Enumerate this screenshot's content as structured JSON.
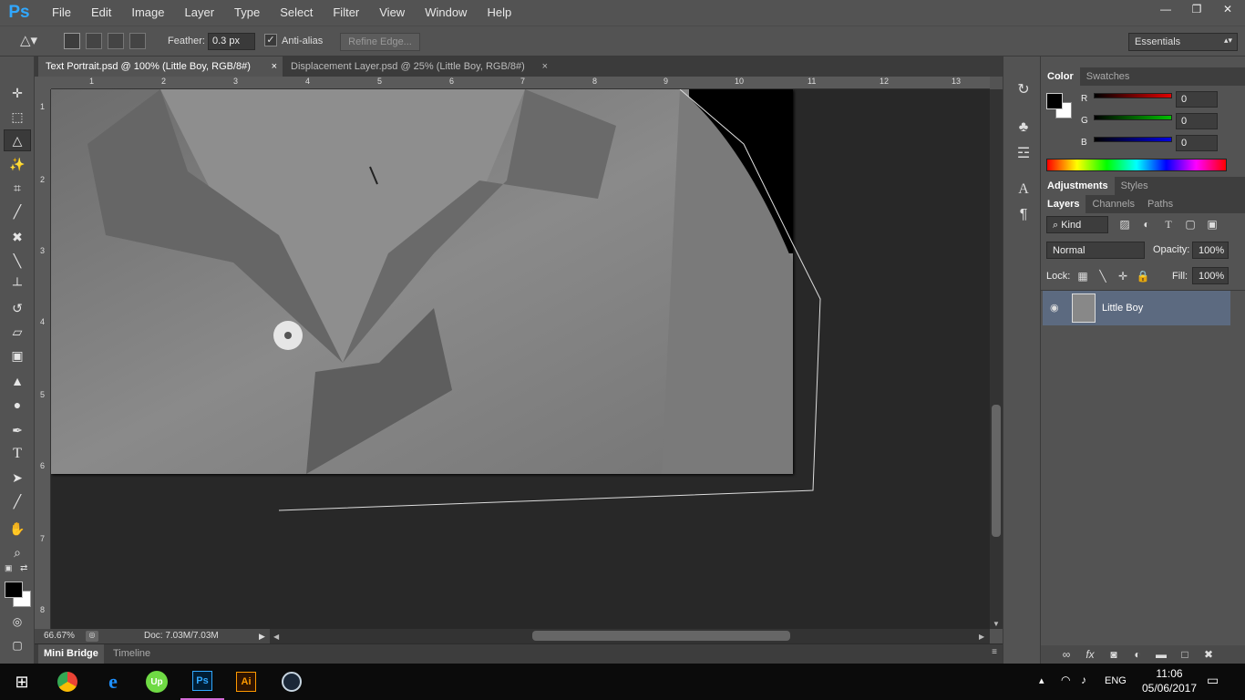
{
  "app": {
    "logo": "Ps"
  },
  "menu": [
    "File",
    "Edit",
    "Image",
    "Layer",
    "Type",
    "Select",
    "Filter",
    "View",
    "Window",
    "Help"
  ],
  "window_controls": [
    "minimize-icon",
    "restore-icon",
    "close-icon"
  ],
  "options": {
    "feather_label": "Feather:",
    "feather_value": "0.3 px",
    "antialias_label": "Anti-alias",
    "antialias_checked": true,
    "refine_edge_label": "Refine Edge...",
    "workspace": "Essentials"
  },
  "doc_tabs": [
    {
      "title": "Text Portrait.psd @ 100% (Little Boy, RGB/8#)",
      "active": true
    },
    {
      "title": "Displacement Layer.psd @ 25% (Little Boy, RGB/8#)",
      "active": false
    }
  ],
  "ruler": {
    "top": [
      "1",
      "2",
      "3",
      "4",
      "5",
      "6",
      "7",
      "8",
      "9",
      "10",
      "11",
      "12",
      "13"
    ],
    "left": [
      "1",
      "2",
      "3",
      "4",
      "5",
      "6",
      "7",
      "8"
    ]
  },
  "status": {
    "zoom": "66.67%",
    "doc": "Doc: 7.03M/7.03M"
  },
  "bridge_tabs": [
    "Mini Bridge",
    "Timeline"
  ],
  "color_panel": {
    "tabs": [
      "Color",
      "Swatches"
    ],
    "channels": [
      {
        "label": "R",
        "value": "0",
        "color": "#e00000"
      },
      {
        "label": "G",
        "value": "0",
        "color": "#00c000"
      },
      {
        "label": "B",
        "value": "0",
        "color": "#0000e0"
      }
    ],
    "foreground": "#000000",
    "background": "#ffffff"
  },
  "adjustments_tabs": [
    "Adjustments",
    "Styles"
  ],
  "layers_panel": {
    "tabs": [
      "Layers",
      "Channels",
      "Paths"
    ],
    "filter_kind": "Kind",
    "blend_mode": "Normal",
    "opacity_label": "Opacity:",
    "opacity": "100%",
    "lock_label": "Lock:",
    "fill_label": "Fill:",
    "fill": "100%",
    "layers": [
      {
        "name": "Little Boy",
        "visible": true,
        "selected": true
      }
    ]
  },
  "taskbar": {
    "apps": [
      "chrome-icon",
      "edge-icon",
      "upwork-icon",
      "photoshop-icon",
      "illustrator-icon",
      "steam-icon"
    ],
    "app_labels": {
      "upwork": "Up",
      "photoshop": "Ps",
      "illustrator": "Ai"
    },
    "lang": "ENG",
    "time": "11:06",
    "date": "05/06/2017"
  }
}
